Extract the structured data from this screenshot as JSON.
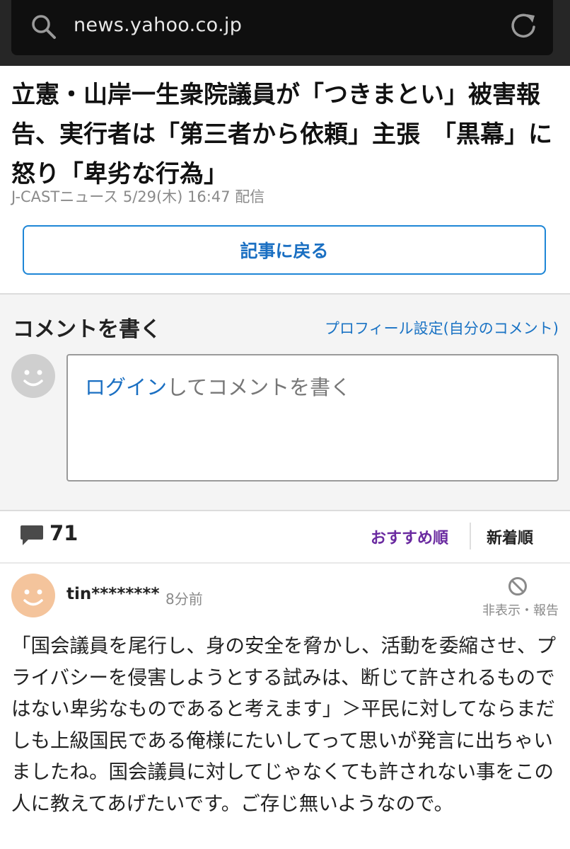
{
  "browser": {
    "url": "news.yahoo.co.jp"
  },
  "article": {
    "title": "立憲・山岸一生衆院議員が「つきまとい」被害報告、実行者は「第三者から依頼」主張　「黒幕」に怒り「卑劣な行為」",
    "meta": "J-CASTニュース 5/29(木) 16:47 配信",
    "back_label": "記事に戻る"
  },
  "comment_form": {
    "heading": "コメントを書く",
    "profile_link": "プロフィール設定(自分のコメント)",
    "login_link": "ログイン",
    "placeholder_rest": "してコメントを書く"
  },
  "comments_bar": {
    "count": "71",
    "sort_recommended": "おすすめ順",
    "sort_newest": "新着順"
  },
  "comments": [
    {
      "user": "tin********",
      "time": "8分前",
      "actions": "非表示・報告",
      "body": "「国会議員を尾行し、身の安全を脅かし、活動を委縮させ、プライバシーを侵害しようとする試みは、断じて許されるものではない卑劣なものであると考えます」＞平民に対してならまだしも上級国民である俺様にたいしてって思いが発言に出ちゃいましたね。国会議員に対してじゃなくても許されない事をこの人に教えてあげたいです。ご存じ無いようなので。"
    }
  ],
  "colors": {
    "accent_blue": "#1a6fc2",
    "sort_purple": "#6a2aa0",
    "avatar_orange": "#f4c49c"
  },
  "icons": [
    "search-icon",
    "reload-icon",
    "avatar-icon",
    "speech-bubble-icon",
    "block-icon"
  ]
}
